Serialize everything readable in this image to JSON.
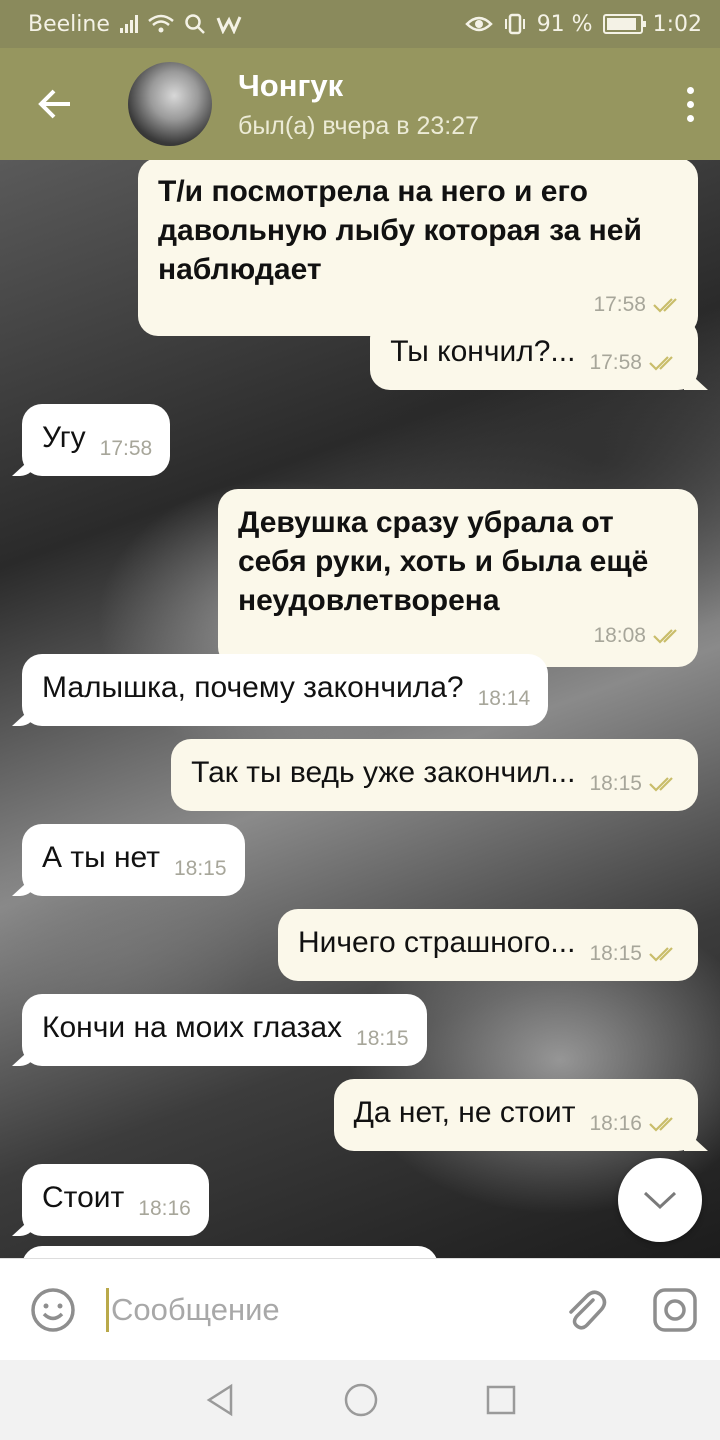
{
  "status_bar": {
    "carrier": "Beeline",
    "battery_percent": "91 %",
    "time": "1:02",
    "battery_level": 0.91
  },
  "header": {
    "name": "Чонгук",
    "status": "был(а) вчера в 23:27"
  },
  "messages": [
    {
      "dir": "out",
      "text": "Т/и посмотрела на него и его давольную лыбу которая за ней наблюдает",
      "time": "17:58"
    },
    {
      "dir": "out",
      "text": "Ты кончил?...",
      "time": "17:58"
    },
    {
      "dir": "in",
      "text": "Угу",
      "time": "17:58"
    },
    {
      "dir": "out",
      "text": "Девушка сразу убрала от себя руки, хоть и была ещё неудовлетворена",
      "time": "18:08"
    },
    {
      "dir": "in",
      "text": "Малышка, почему закончила?",
      "time": "18:14"
    },
    {
      "dir": "out",
      "text": "Так ты ведь уже закончил...",
      "time": "18:15"
    },
    {
      "dir": "in",
      "text": "А ты нет",
      "time": "18:15"
    },
    {
      "dir": "out",
      "text": "Ничего страшного...",
      "time": "18:15"
    },
    {
      "dir": "in",
      "text": "Кончи на моих глазах",
      "time": "18:15"
    },
    {
      "dir": "out",
      "text": "Да нет, не стоит",
      "time": "18:16"
    },
    {
      "dir": "in",
      "text": "Стоит",
      "time": "18:16"
    }
  ],
  "input": {
    "placeholder": "Сообщение"
  },
  "icons": {
    "back": "arrow-left-icon",
    "menu": "more-vertical-icon",
    "emoji": "smile-icon",
    "attach": "paperclip-icon",
    "camera": "camera-icon",
    "scroll": "chevron-down-icon"
  },
  "colors": {
    "header": "#96965f",
    "status_bar": "#8a8a5c",
    "outgoing_bubble": "#fbf8ea",
    "incoming_bubble": "#ffffff",
    "ticks": "#c9bd6a"
  }
}
